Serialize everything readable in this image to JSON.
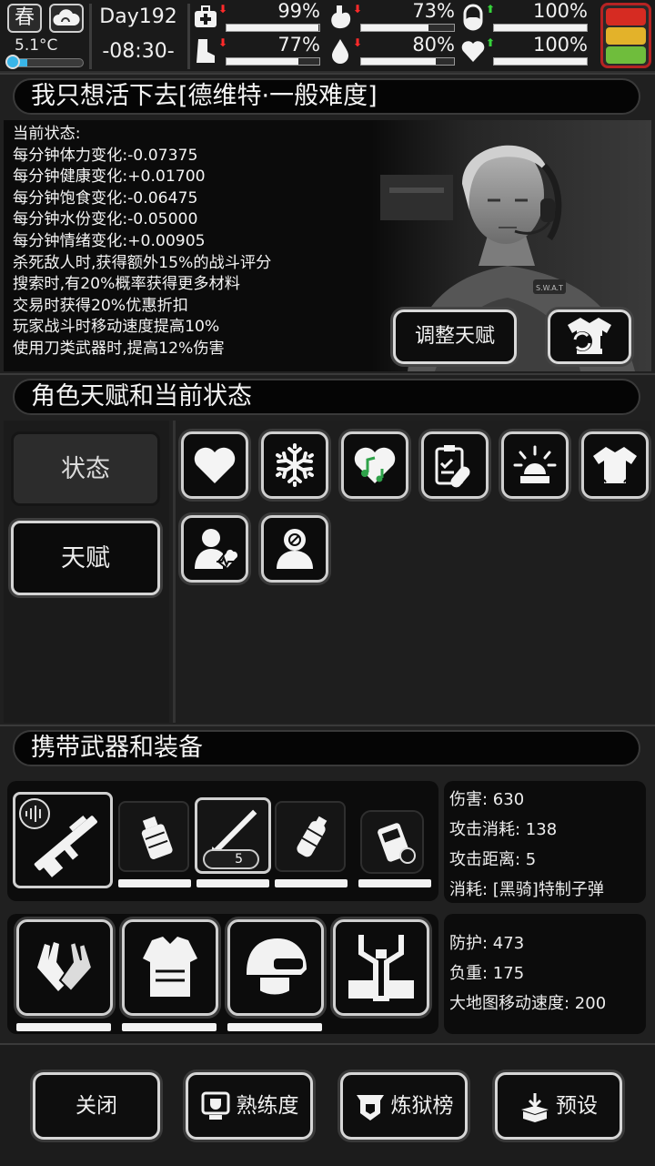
{
  "top": {
    "season": "春",
    "temperature": "5.1°C",
    "temperature_level": 0.25,
    "day": "Day192",
    "time": "-08:30-",
    "stats": [
      {
        "name": "health",
        "icon": "medkit-icon",
        "value": "99%",
        "level": 0.99,
        "trend": "down"
      },
      {
        "name": "hunger",
        "icon": "stomach-icon",
        "value": "73%",
        "level": 0.73,
        "trend": "down"
      },
      {
        "name": "pill",
        "icon": "pill-icon",
        "value": "100%",
        "level": 1.0,
        "trend": "up"
      },
      {
        "name": "stamina",
        "icon": "boot-icon",
        "value": "77%",
        "level": 0.77,
        "trend": "down"
      },
      {
        "name": "water",
        "icon": "water-drop-icon",
        "value": "80%",
        "level": 0.8,
        "trend": "down"
      },
      {
        "name": "mood",
        "icon": "heart-icon",
        "value": "100%",
        "level": 1.0,
        "trend": "up"
      }
    ],
    "trend_down": "⬇",
    "trend_up": "⬆"
  },
  "colors": {
    "traffic_red": "#d62b22",
    "traffic_yellow": "#e3b22a",
    "traffic_green": "#6fbd3c"
  },
  "character": {
    "title": "我只想活下去[德维特·一般难度]",
    "status_lines": [
      "当前状态:",
      "每分钟体力变化:-0.07375",
      "每分钟健康变化:+0.01700",
      "每分钟饱食变化:-0.06475",
      "每分钟水份变化:-0.05000",
      "每分钟情绪变化:+0.00905",
      "杀死敌人时,获得额外15%的战斗评分",
      "搜索时,有20%概率获得更多材料",
      "交易时获得20%优惠折扣",
      "玩家战斗时移动速度提高10%",
      "使用刀类武器时,提高12%伤害"
    ],
    "adjust_talent_label": "调整天赋",
    "portrait_badge": "S.W.A.T"
  },
  "talents": {
    "title": "角色天赋和当前状态",
    "tabs": [
      "状态",
      "天赋"
    ],
    "icons": [
      "heart-icon",
      "snowflake-icon",
      "music-heart-icon",
      "clipboard-pill-icon",
      "alarm-light-icon",
      "shirt-icon",
      "person-heartbeat-icon",
      "person-head-icon"
    ]
  },
  "equipment": {
    "title": "携带武器和装备",
    "ammo_count": "5",
    "weapon_info": [
      "伤害: 630",
      "攻击消耗: 138",
      "攻击距离: 5",
      "消耗: [黑骑]特制子弹"
    ],
    "armor_info": [
      "防护: 473",
      "负重: 175",
      "大地图移动速度: 200"
    ]
  },
  "bottom_buttons": [
    {
      "label": "关闭",
      "icon": ""
    },
    {
      "label": "熟练度",
      "icon": "trophy-screen-icon"
    },
    {
      "label": "炼狱榜",
      "icon": "banner-shield-icon"
    },
    {
      "label": "预设",
      "icon": "download-box-icon"
    }
  ]
}
